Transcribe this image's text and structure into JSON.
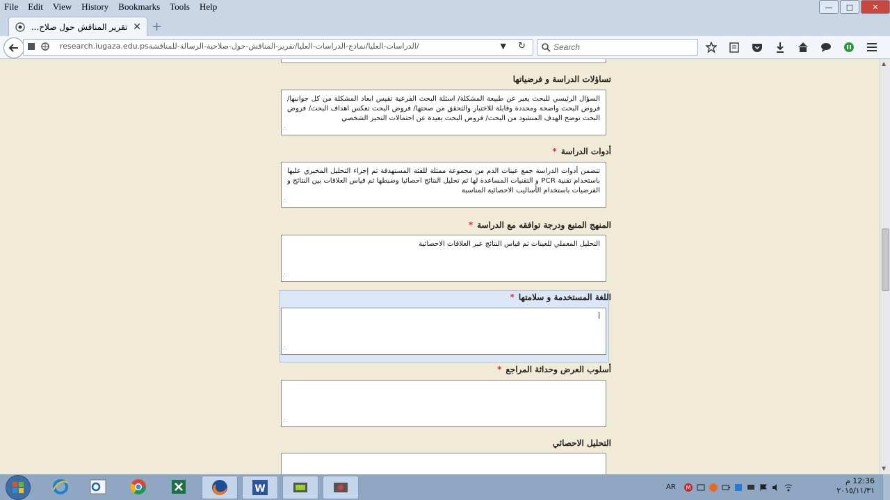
{
  "menubar": {
    "items": [
      "File",
      "Edit",
      "View",
      "History",
      "Bookmarks",
      "Tools",
      "Help"
    ]
  },
  "tab": {
    "title": "تقرير المناقش حول صلاح..."
  },
  "navbar": {
    "url_domain": "research.iugaza.edu.ps",
    "url_path": "/الدراسات-العليا/نماذج-الدراسات-العليا/تقرير-المناقش-حول-صلاحية-الرسالة-للمناقشة",
    "search_placeholder": "Search"
  },
  "form": {
    "fields": [
      {
        "label": "تساؤلات الدراسة و فرضياتها",
        "required": false,
        "value": "السؤال الرئيسي للبحث يعبر عن طبيعة المشكلة/ اسئلة البحث الفرعية تقيس ابعاد المشكلة من كل جوانبها/ فروض البحث واضحة ومحددة وقابلة للاختبار والتحقق من صحتها/ فروض البحث تعكس اهداف البحث/ فروض البحث توضح الهدف المنشود من البحث/ فروض البحث بعيدة عن احتمالات التحيز الشخصي"
      },
      {
        "label": "أدوات الدراسة",
        "required": true,
        "value": "تتضمن أدوات الدراسة جمع عينات الدم من مجموعة ممثلة للفئة المستهدفة ثم إجراء التحليل المخبري عليها باستخدام تقنية PCR و التقنيات المساعدة لها ثم تحليل النتائج احصائيا وضبطها ثم قياس العلاقات بين النتائج و الفرضيات باستخدام الأساليب الاحصائية المناسبة"
      },
      {
        "label": "المنهج المتبع ودرجة توافقه مع الدراسة",
        "required": true,
        "value": "التحليل المعملي للعينات ثم قياس النتائج عبر العلاقات الاحصائية"
      },
      {
        "label": "اللغة المستخدمة و سلامتها",
        "required": true,
        "value": "أ"
      },
      {
        "label": "أسلوب العرض وحداثة المراجع",
        "required": true,
        "value": ""
      },
      {
        "label": "التحليل الاحصائي",
        "required": false,
        "value": ""
      }
    ]
  },
  "taskbar": {
    "lang": "AR",
    "time": "12:36 م",
    "date": "٢٠١٥/١١/٣١"
  },
  "colors": {
    "required": "#d0202c",
    "highlight": "#dbe7f6",
    "page_bg": "#f0ead6"
  }
}
